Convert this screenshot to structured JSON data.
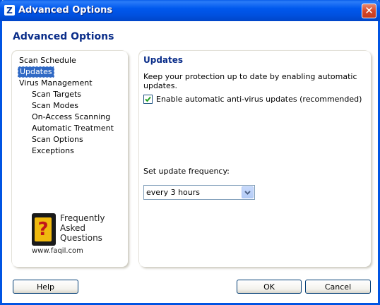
{
  "window": {
    "title": "Advanced Options",
    "app_icon_glyph": "Z",
    "close_glyph": "✕"
  },
  "header": {
    "title": "Advanced Options"
  },
  "tree": {
    "items": [
      {
        "label": "Scan Schedule"
      },
      {
        "label": "Updates",
        "selected": true
      },
      {
        "label": "Virus Management"
      },
      {
        "label": "Scan Targets"
      },
      {
        "label": "Scan Modes"
      },
      {
        "label": "On-Access Scanning"
      },
      {
        "label": "Automatic Treatment"
      },
      {
        "label": "Scan Options"
      },
      {
        "label": "Exceptions"
      }
    ]
  },
  "faq": {
    "glyph": "?",
    "line1": "Frequently",
    "line2": "Asked",
    "line3": "Questions",
    "url": "www.faqil.com"
  },
  "updates": {
    "title": "Updates",
    "description": "Keep your protection up to date by enabling automatic updates.",
    "checkbox_label": "Enable automatic anti-virus updates (recommended)",
    "checkbox_checked": true,
    "frequency_label": "Set update frequency:",
    "frequency_value": "every 3 hours"
  },
  "buttons": {
    "help": "Help",
    "ok": "OK",
    "cancel": "Cancel"
  },
  "colors": {
    "selection": "#316ac5",
    "heading": "#0b2e8a",
    "titlebar": "#0058ee"
  }
}
